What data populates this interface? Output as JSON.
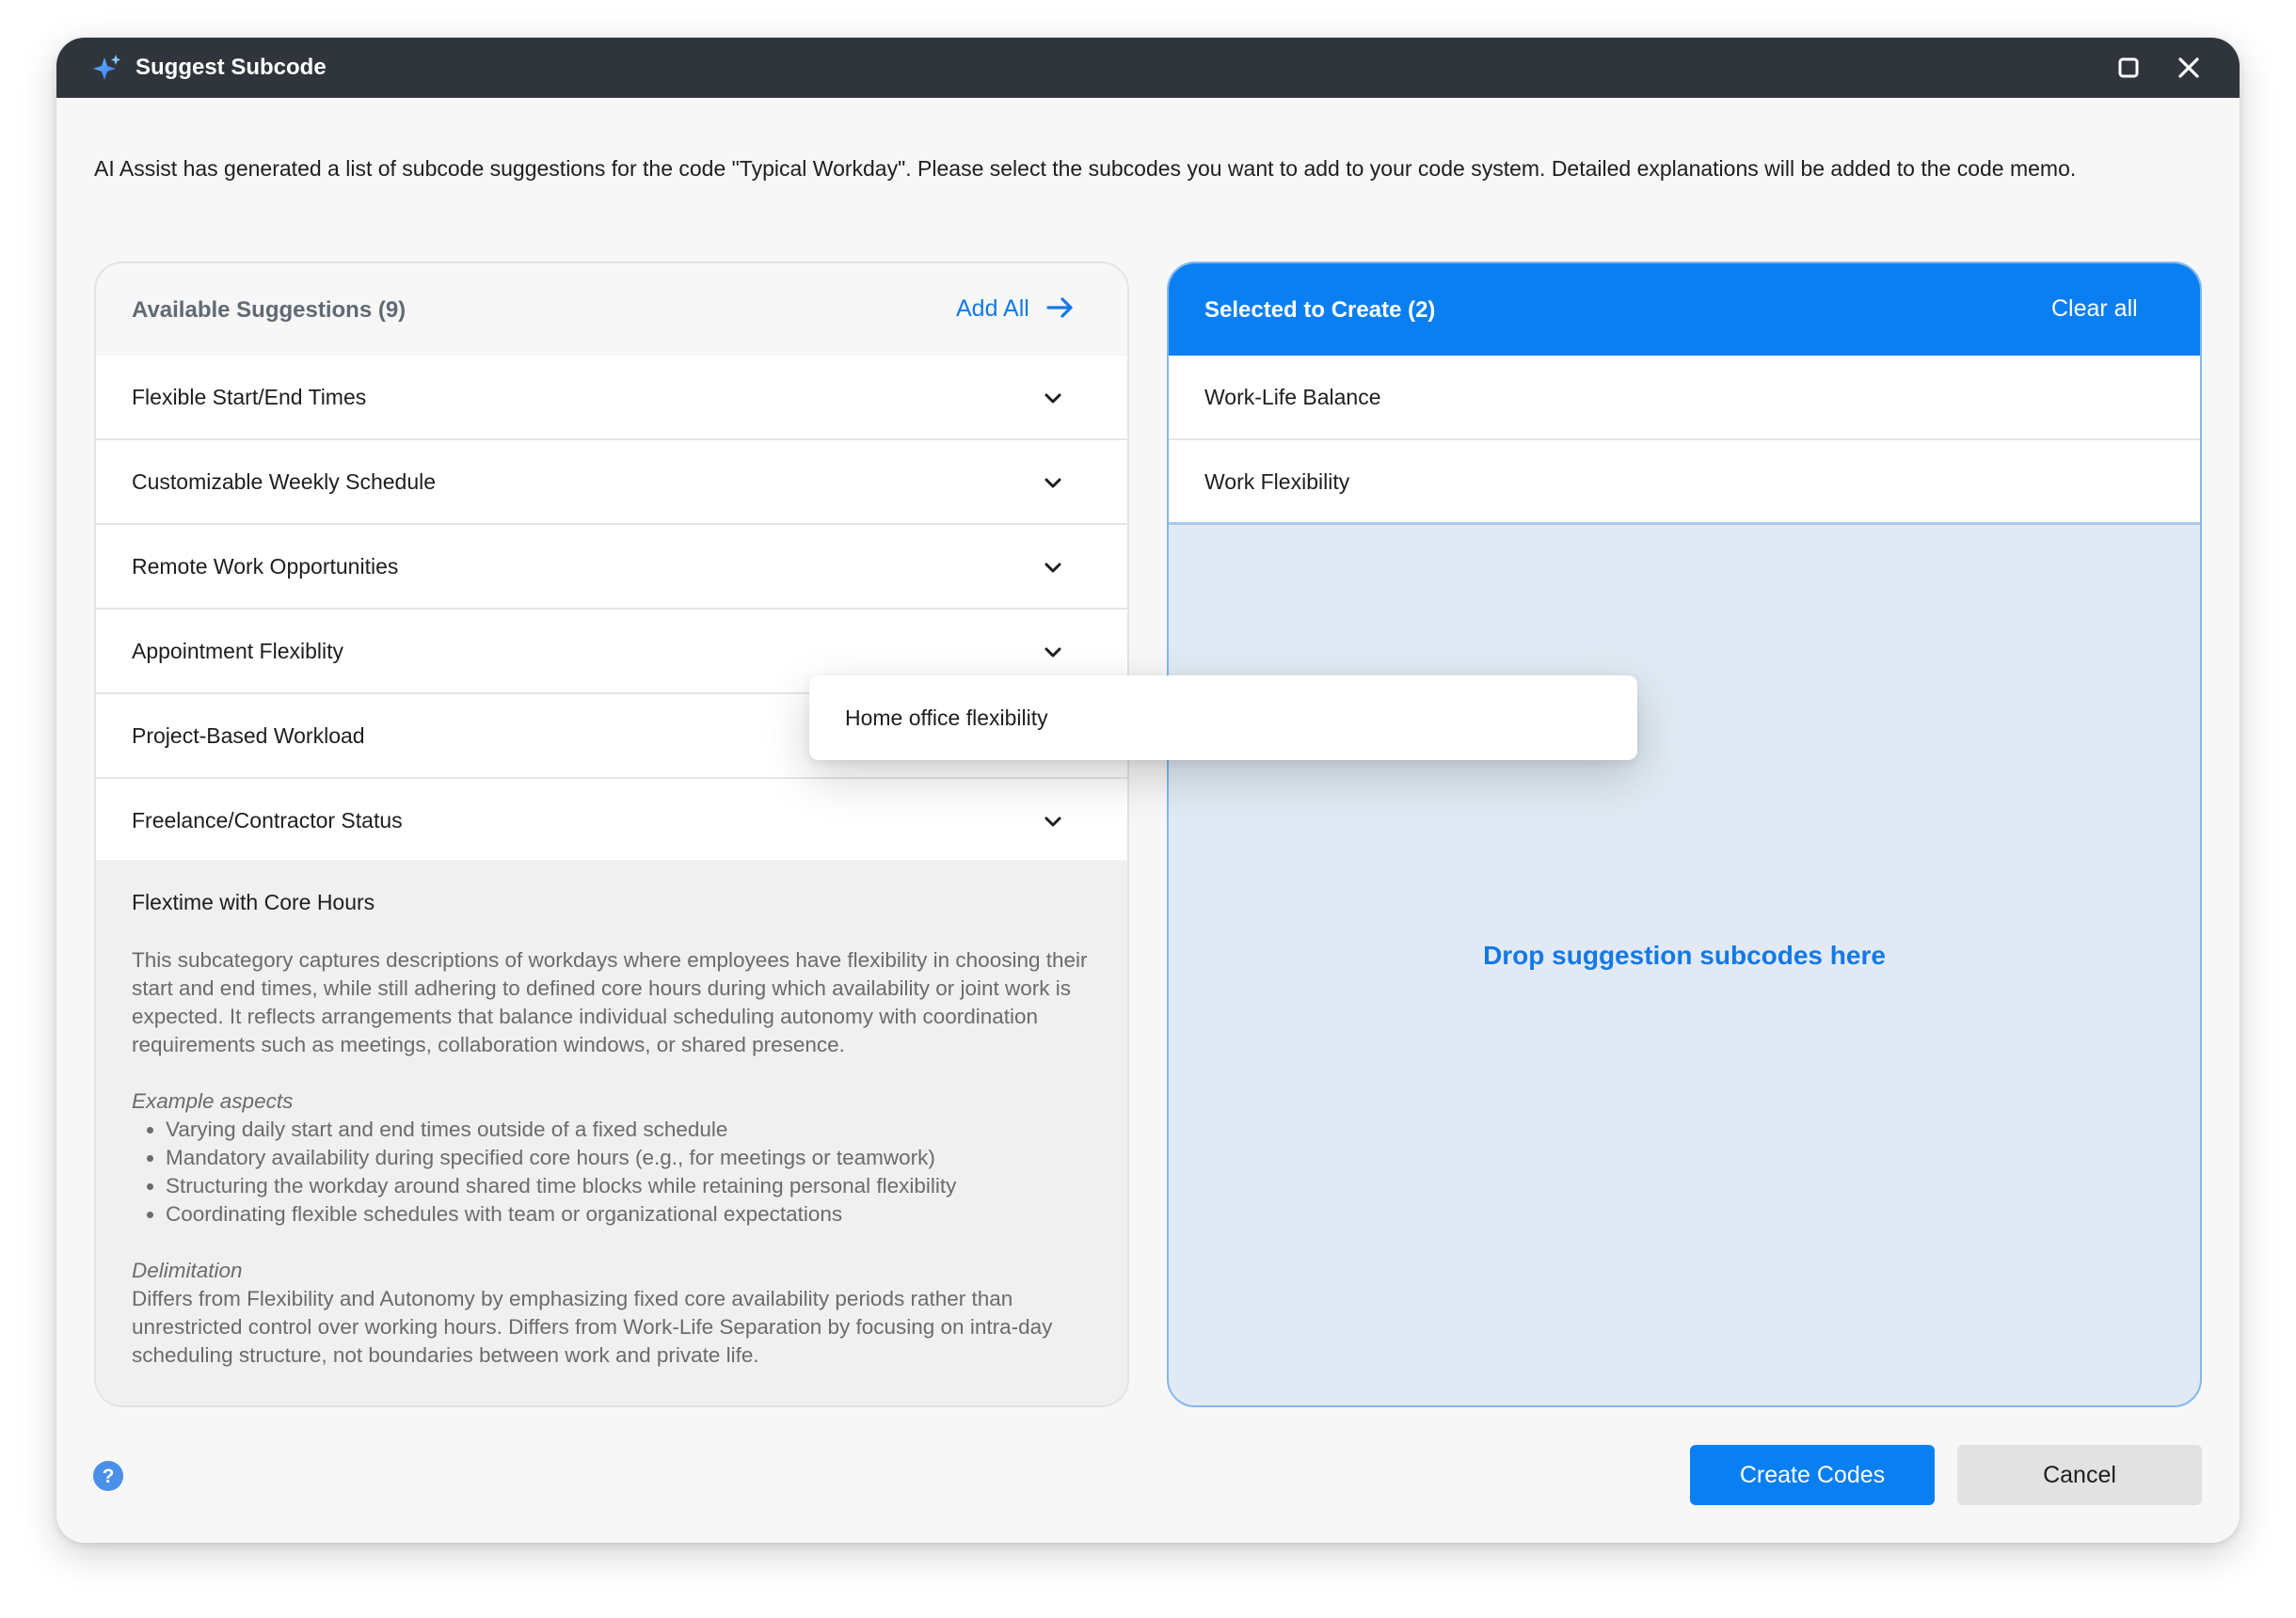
{
  "window": {
    "title": "Suggest Subcode"
  },
  "intro_text": "AI Assist has generated a list of subcode suggestions for the code \"Typical Workday\". Please select the subcodes you want to add to your code system. Detailed explanations will be added to the code memo.",
  "available": {
    "header": "Available Suggestions (9)",
    "add_all_label": "Add All",
    "items": [
      {
        "label": "Flexible Start/End Times"
      },
      {
        "label": "Customizable Weekly Schedule"
      },
      {
        "label": "Remote Work Opportunities"
      },
      {
        "label": "Appointment Flexiblity"
      },
      {
        "label": "Project-Based Workload"
      },
      {
        "label": "Freelance/Contractor Status"
      }
    ],
    "expanded": {
      "title": "Flextime with Core Hours",
      "description": "This subcategory captures descriptions of workdays where employees have flexibility in choosing their start and end times, while still adhering to defined core hours during which availability or joint work is expected. It reflects arrangements that balance individual scheduling autonomy with coordination requirements such as meetings, collaboration windows, or shared presence.",
      "examples_heading": "Example aspects",
      "examples": [
        "Varying daily start and end times outside of a fixed schedule",
        "Mandatory availability during specified core hours (e.g., for meetings or teamwork)",
        "Structuring the workday around shared time blocks while retaining personal flexibility",
        "Coordinating flexible schedules with team or organizational expectations"
      ],
      "delimitation_heading": "Delimitation",
      "delimitation": "Differs from Flexibility and Autonomy by emphasizing fixed core availability periods rather than unrestricted control over working hours. Differs from Work-Life Separation by focusing on intra-day scheduling structure, not boundaries between work and private life."
    }
  },
  "selected": {
    "header": "Selected to Create (2)",
    "clear_all_label": "Clear all",
    "items": [
      {
        "label": "Work-Life Balance"
      },
      {
        "label": "Work Flexibility"
      }
    ],
    "drop_hint": "Drop suggestion subcodes here"
  },
  "drag_ghost": {
    "label": "Home office flexibility"
  },
  "footer": {
    "create_label": "Create Codes",
    "cancel_label": "Cancel"
  },
  "colors": {
    "accent": "#0a7ff2",
    "titlebar": "#2f353b",
    "drop_zone": "#e1eaf4"
  },
  "icons": {
    "title": "sparkle-icon",
    "maximize": "maximize-icon",
    "close": "close-icon",
    "add_all": "arrow-right-icon",
    "expand": "chevron-down-icon",
    "help": "help-icon"
  }
}
